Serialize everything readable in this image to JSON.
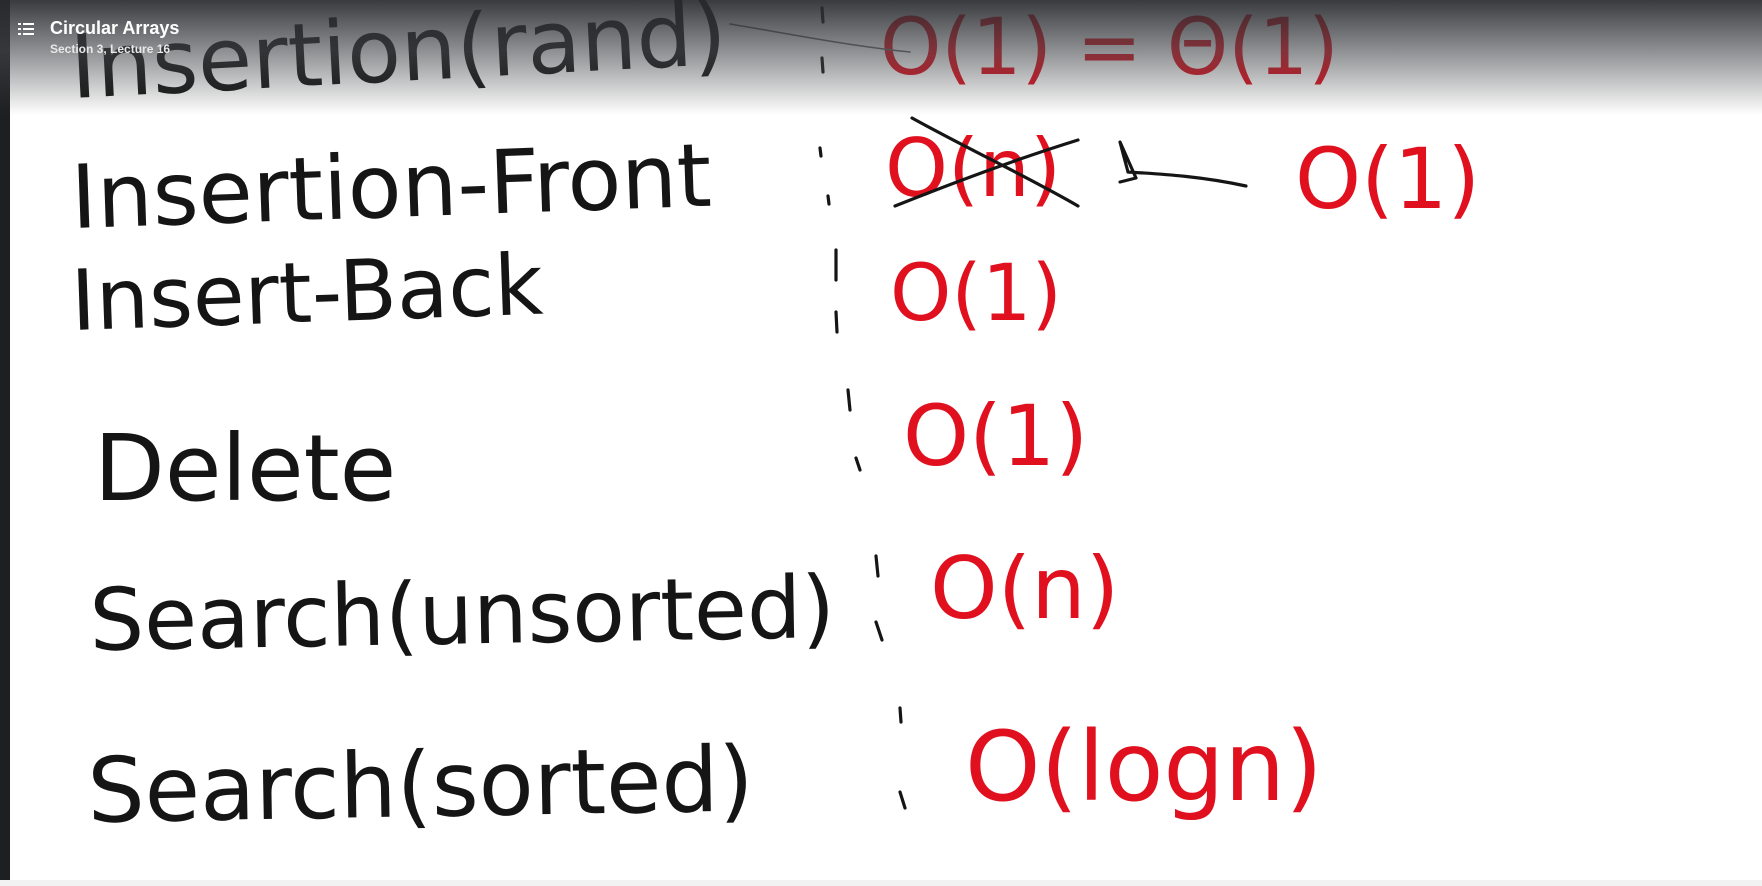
{
  "player": {
    "menu_icon": "list-icon",
    "lecture_title": "Circular Arrays",
    "lecture_subtitle": "Section 3, Lecture 16"
  },
  "whiteboard": {
    "ink_colors": {
      "labels": "#151515",
      "complexities": "#e0101e"
    },
    "rows": [
      {
        "operation": "Insertion(rand)",
        "complexity": "O(1) = Θ(1)"
      },
      {
        "operation": "Insertion-Front",
        "complexity_struck": "O(n)",
        "complexity": "O(1)"
      },
      {
        "operation": "Insert-Back",
        "complexity": "O(1)"
      },
      {
        "operation": "Delete",
        "complexity": "O(1)"
      },
      {
        "operation": "Search(unsorted)",
        "complexity": "O(n)"
      },
      {
        "operation": "Search(sorted)",
        "complexity": "O(logn)"
      }
    ]
  }
}
